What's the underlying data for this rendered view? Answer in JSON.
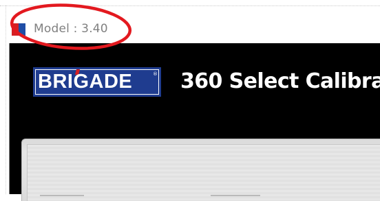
{
  "window": {
    "title": "Model : 3.40",
    "icon": "app-flag-icon"
  },
  "annotation": {
    "shape": "ellipse",
    "color": "#e3191f"
  },
  "app": {
    "logo_text": "BRIGADE",
    "logo_mark": "®",
    "title": "360 Select Calibra",
    "colors": {
      "background": "#000000",
      "logo_blue": "#1f3c8f",
      "logo_red": "#d42024"
    }
  }
}
